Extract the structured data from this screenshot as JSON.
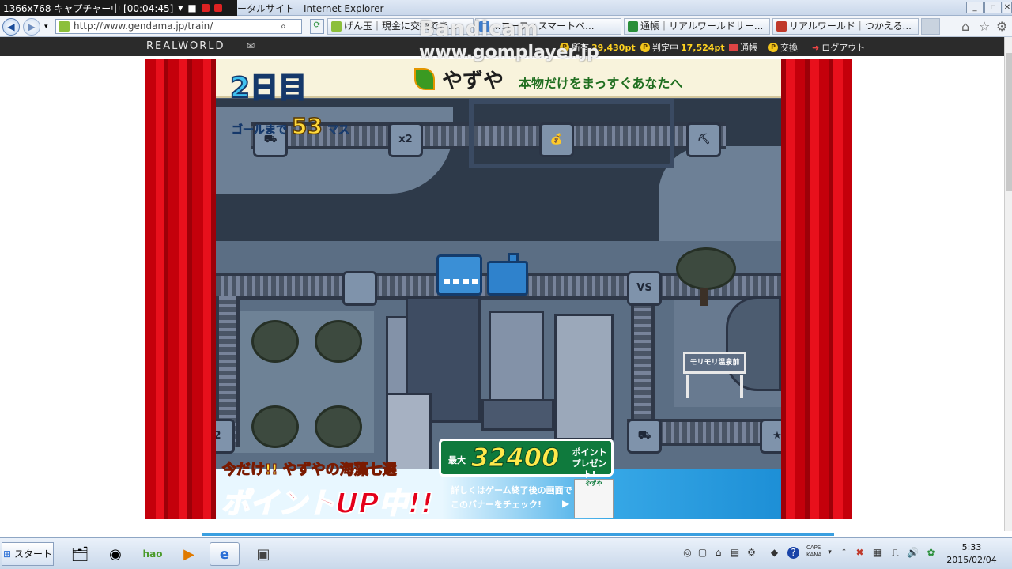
{
  "recorder": {
    "label": "1366x768 キャプチャー中 [00:04:45]"
  },
  "window": {
    "title_fragment": "ータルサイト - Internet Explorer"
  },
  "watermark": {
    "brand": "Bandicam",
    "url": "www.gomplayer.jp"
  },
  "browser": {
    "address": "http://www.gendama.jp/train/",
    "tabs": [
      {
        "label": "げん玉｜現金に交換でき...",
        "icon_color": "#8cbf3b"
      },
      {
        "label": "...コーフィスマートペ...",
        "icon_color": "#3b7fd6"
      },
      {
        "label": "通帳｜リアルワールドサー...",
        "icon_color": "#2a8f3a"
      },
      {
        "label": "リアルワールド｜つかえる...",
        "icon_color": "#c0392b"
      }
    ]
  },
  "sitebar": {
    "logo": "REALWORLD",
    "owned_label": "所有",
    "owned_value": "39,430pt",
    "pending_label": "判定中",
    "pending_value": "17,524pt",
    "passbook": "通帳",
    "exchange": "交換",
    "logout": "ログアウト"
  },
  "game": {
    "day": "2日目",
    "goal_prefix": "ゴールまで",
    "goal_remaining": "53",
    "goal_suffix": "マス",
    "tile_x2": "x2",
    "tile_vs": "VS",
    "tile_2": "2",
    "station_sign": "モリモリ温泉前"
  },
  "sponsor": {
    "brand": "やずや",
    "tagline": "本物だけをまっすぐあなたへ",
    "promo_sub": "今だけ!! やずやの海藻七選",
    "promo_main": "ポイントUP中!!",
    "points_max": "最大",
    "points_value": "32400",
    "points_unit": "ポイント プレゼント!",
    "note_line1": "詳しくはゲーム終了後の画面で",
    "note_line2": "このバナーをチェック!"
  },
  "taskbar": {
    "start": "スタート",
    "time": "5:33",
    "date": "2015/02/04",
    "caps": "CAPS",
    "kana": "KANA"
  }
}
